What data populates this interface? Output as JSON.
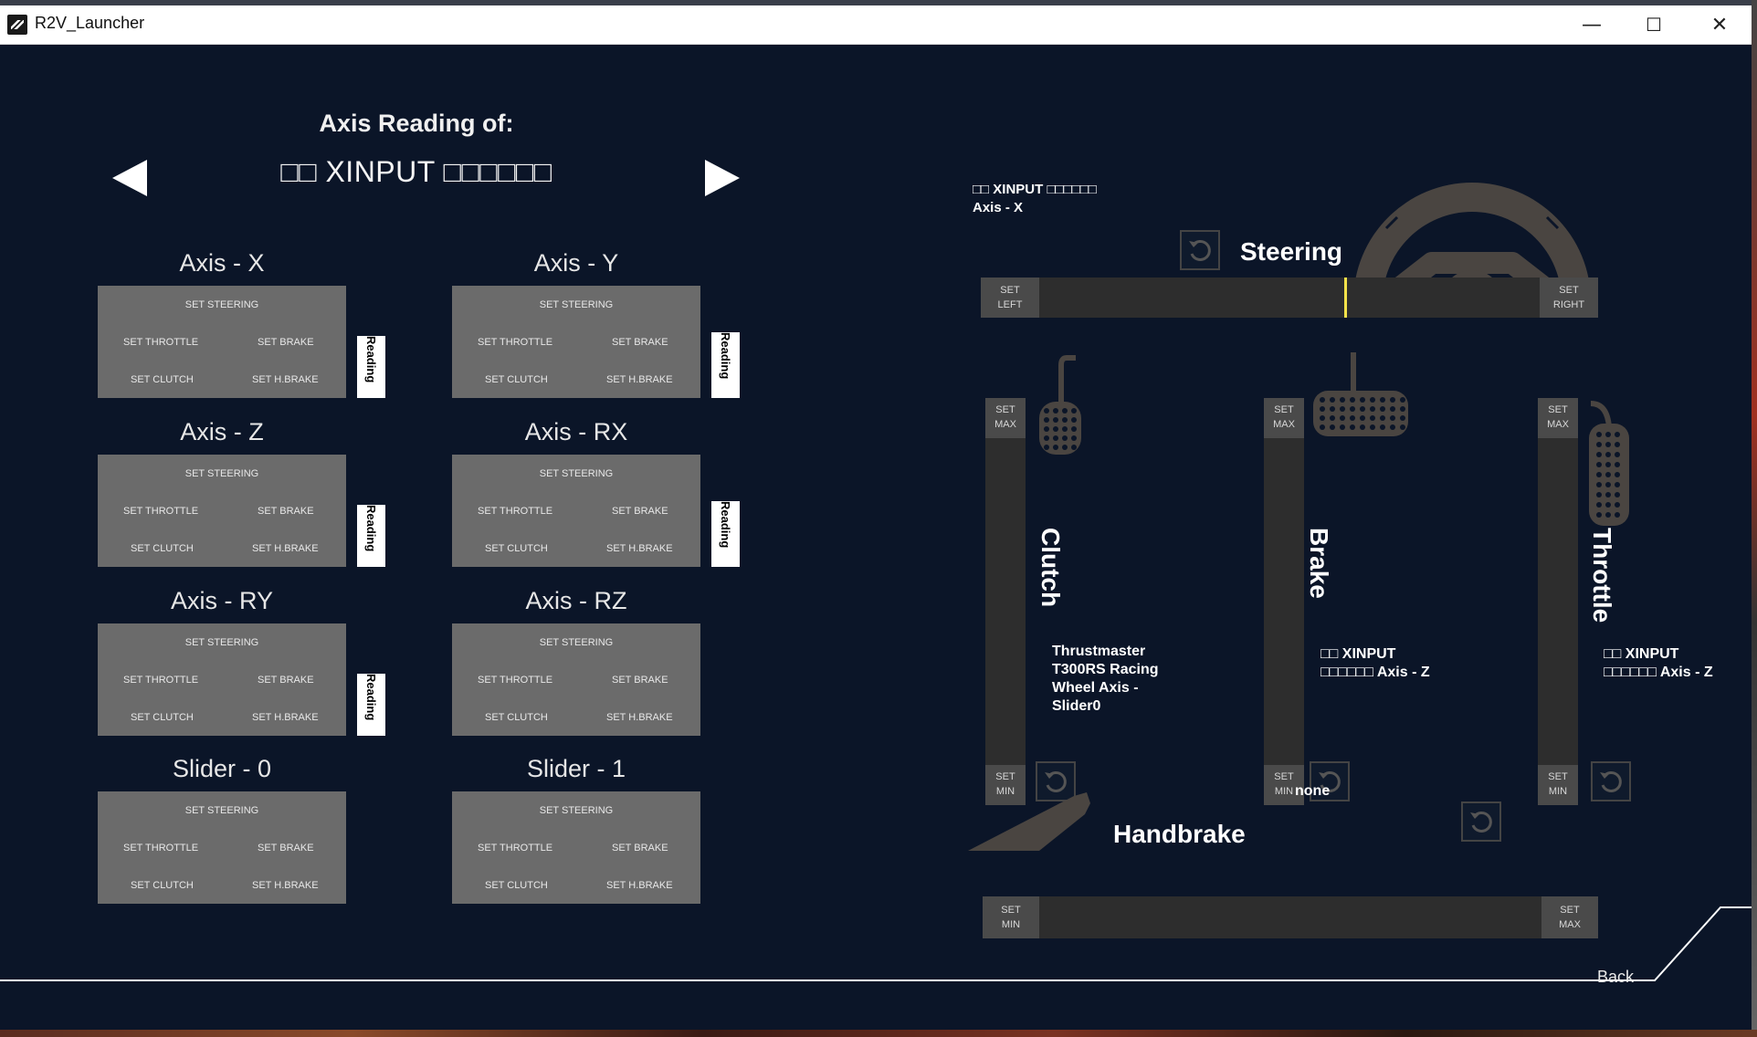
{
  "window": {
    "title": "R2V_Launcher",
    "controls": {
      "minimize": "—",
      "maximize": "☐",
      "close": "✕"
    }
  },
  "header": {
    "title": "Axis Reading of:",
    "device": "□□ XINPUT □□□□□□"
  },
  "options": {
    "steering": "SET STEERING",
    "throttle": "SET THROTTLE",
    "brake": "SET BRAKE",
    "clutch": "SET CLUTCH",
    "handbrake": "SET H.BRAKE",
    "reading": "Reading"
  },
  "axes": [
    {
      "label": "Axis - X",
      "reading": true
    },
    {
      "label": "Axis - Y",
      "reading": true
    },
    {
      "label": "Axis - Z",
      "reading": true
    },
    {
      "label": "Axis - RX",
      "reading": true
    },
    {
      "label": "Axis - RY",
      "reading": true
    },
    {
      "label": "Axis - RZ",
      "reading": false
    },
    {
      "label": "Slider - 0",
      "reading": false
    },
    {
      "label": "Slider - 1",
      "reading": false
    }
  ],
  "steering": {
    "title": "Steering",
    "device_line1": "□□ XINPUT □□□□□□",
    "device_line2": "Axis - X",
    "set_left": [
      "SET",
      "LEFT"
    ],
    "set_right": [
      "SET",
      "RIGHT"
    ],
    "position": 0.61
  },
  "pedals": {
    "set_max": [
      "SET",
      "MAX"
    ],
    "set_min": [
      "SET",
      "MIN"
    ],
    "clutch": {
      "name": "Clutch",
      "info": [
        "Thrustmaster",
        "T300RS Racing",
        "Wheel Axis -",
        "Slider0"
      ]
    },
    "brake": {
      "name": "Brake",
      "info": [
        "□□ XINPUT",
        "□□□□□□ Axis - Z"
      ]
    },
    "throttle": {
      "name": "Throttle",
      "info": [
        "□□ XINPUT",
        "□□□□□□ Axis - Z"
      ]
    }
  },
  "handbrake": {
    "title": "Handbrake",
    "status": "none",
    "set_min": [
      "SET",
      "MIN"
    ],
    "set_max": [
      "SET",
      "MAX"
    ]
  },
  "footer": {
    "back": "Back"
  },
  "colors": {
    "background": "#0b1528",
    "panel": "#6b6b6b",
    "bar": "#2d2d2d",
    "indicator": "#f5e34a",
    "icon": "#4a4541"
  }
}
